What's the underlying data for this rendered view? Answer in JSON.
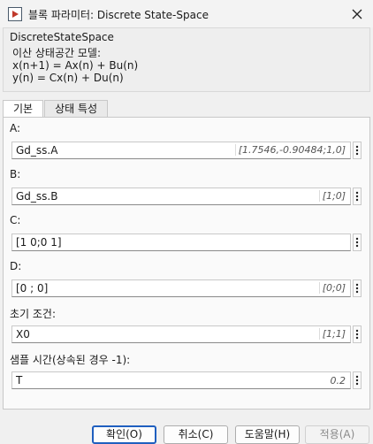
{
  "window": {
    "title": "블록 파라미터: Discrete State-Space",
    "icon": "simulink-block-icon",
    "close_icon": "close-icon"
  },
  "description": {
    "title": "DiscreteStateSpace",
    "lines": [
      "이산 상태공간 모델:",
      "x(n+1) = Ax(n) + Bu(n)",
      "y(n) = Cx(n) + Du(n)"
    ]
  },
  "tabs": [
    {
      "label": "기본",
      "active": true
    },
    {
      "label": "상태 특성",
      "active": false
    }
  ],
  "params": [
    {
      "label": "A:",
      "value": "Gd_ss.A",
      "hint": "[1.7546,-0.90484;1,0]"
    },
    {
      "label": "B:",
      "value": "Gd_ss.B",
      "hint": "[1;0]"
    },
    {
      "label": "C:",
      "value": "[1 0;0 1]",
      "hint": ""
    },
    {
      "label": "D:",
      "value": "[0 ; 0]",
      "hint": "[0;0]"
    },
    {
      "label": "초기 조건:",
      "value": "X0",
      "hint": "[1;1]"
    },
    {
      "label": "샘플 시간(상속된 경우 -1):",
      "value": "T",
      "hint": "0.2"
    }
  ],
  "buttons": {
    "ok": "확인(O)",
    "cancel": "취소(C)",
    "help": "도움말(H)",
    "apply": "적용(A)"
  },
  "colors": {
    "primary_border": "#1f5fbf",
    "panel_bg": "#fafafa",
    "window_bg": "#f0f0f0"
  }
}
